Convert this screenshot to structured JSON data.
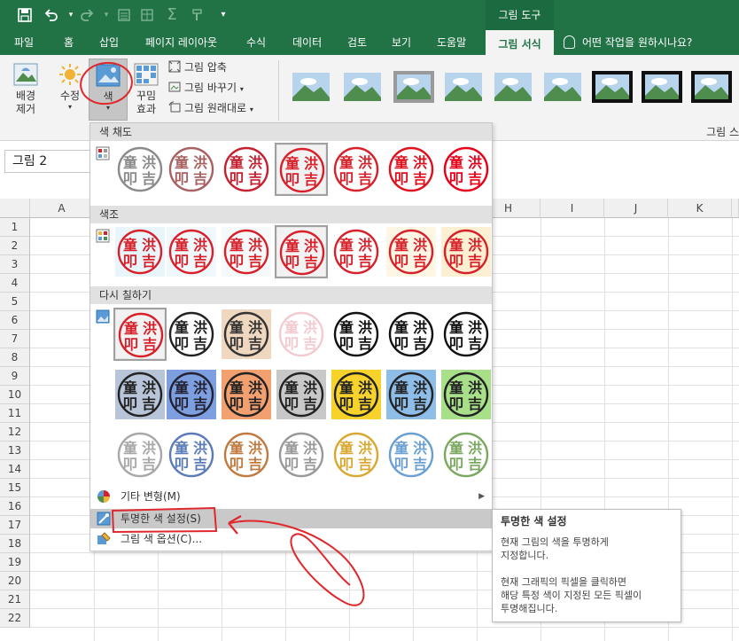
{
  "quick_access": {
    "icons": [
      "save-icon",
      "undo-icon",
      "redo-icon",
      "form-icon",
      "table-icon",
      "sum-icon",
      "format-painter-icon",
      "customize-icon"
    ]
  },
  "contextual_group": "그림 도구",
  "tabs": [
    "파일",
    "홈",
    "삽입",
    "페이지 레이아웃",
    "수식",
    "데이터",
    "검토",
    "보기",
    "도움말",
    "그림 서식"
  ],
  "active_tab": "그림 서식",
  "tell_me": "어떤 작업을 원하시나요?",
  "ribbon": {
    "remove_background": "배경\n제거",
    "corrections": "수정",
    "color": "색",
    "artistic_effects": "꾸밈\n효과",
    "compress_pictures": "그림 압축",
    "change_picture": "그림 바꾸기",
    "reset_picture": "그림 원래대로",
    "picture_styles_group": "그림 스"
  },
  "name_box": "그림 2",
  "columns": [
    "A",
    "H",
    "I",
    "J",
    "K"
  ],
  "rows": [
    "1",
    "2",
    "3",
    "4",
    "5",
    "6",
    "7",
    "8",
    "9",
    "10",
    "11",
    "12",
    "13",
    "14",
    "15",
    "16",
    "17",
    "18",
    "19",
    "20",
    "21",
    "22"
  ],
  "dropdown": {
    "sections": {
      "saturation": "색 채도",
      "tone": "색조",
      "recolor": "다시 칠하기"
    },
    "menu_items": {
      "more_variations": "기타 변형(M)",
      "set_transparent": "투명한 색 설정(S)",
      "color_options": "그림 색 옵션(C)..."
    },
    "stamp_chars": [
      "童",
      "洪",
      "叩",
      "吉"
    ]
  },
  "tooltip": {
    "title": "투명한 색 설정",
    "line1": "현재 그림의 색을 투명하게",
    "line2": "지정합니다.",
    "line3": "현재 그래픽의 픽셀을 클릭하면",
    "line4": "해당 특정 색이 지정된 모든 픽셀이",
    "line5": "투명해집니다."
  },
  "colors": {
    "excel_green": "#217346",
    "stamp_red": "#d8202a",
    "annotation_red": "#e0282c"
  }
}
